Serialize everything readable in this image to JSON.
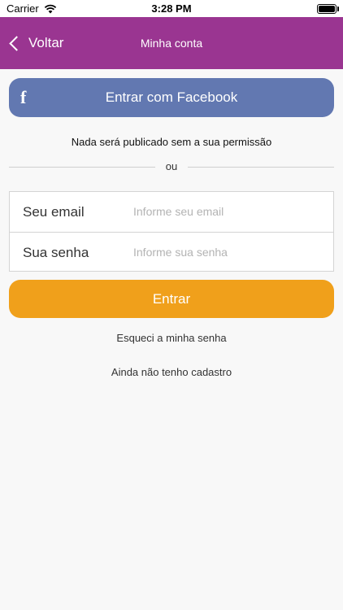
{
  "status_bar": {
    "carrier": "Carrier",
    "time": "3:28 PM",
    "battery_level": 1.0
  },
  "nav": {
    "back_label": "Voltar",
    "title": "Minha conta"
  },
  "facebook": {
    "icon_letter": "f",
    "label": "Entrar com Facebook"
  },
  "notice": "Nada será publicado sem a sua permissão",
  "separator": "ou",
  "form": {
    "email_label": "Seu email",
    "email_placeholder": "Informe seu email",
    "password_label": "Sua senha",
    "password_placeholder": "Informe sua senha"
  },
  "enter_label": "Entrar",
  "forgot_label": "Esqueci a minha senha",
  "register_label": "Ainda não tenho cadastro",
  "colors": {
    "nav_background": "#9a3591",
    "facebook_button": "#6278b1",
    "enter_button": "#f0a01b"
  }
}
